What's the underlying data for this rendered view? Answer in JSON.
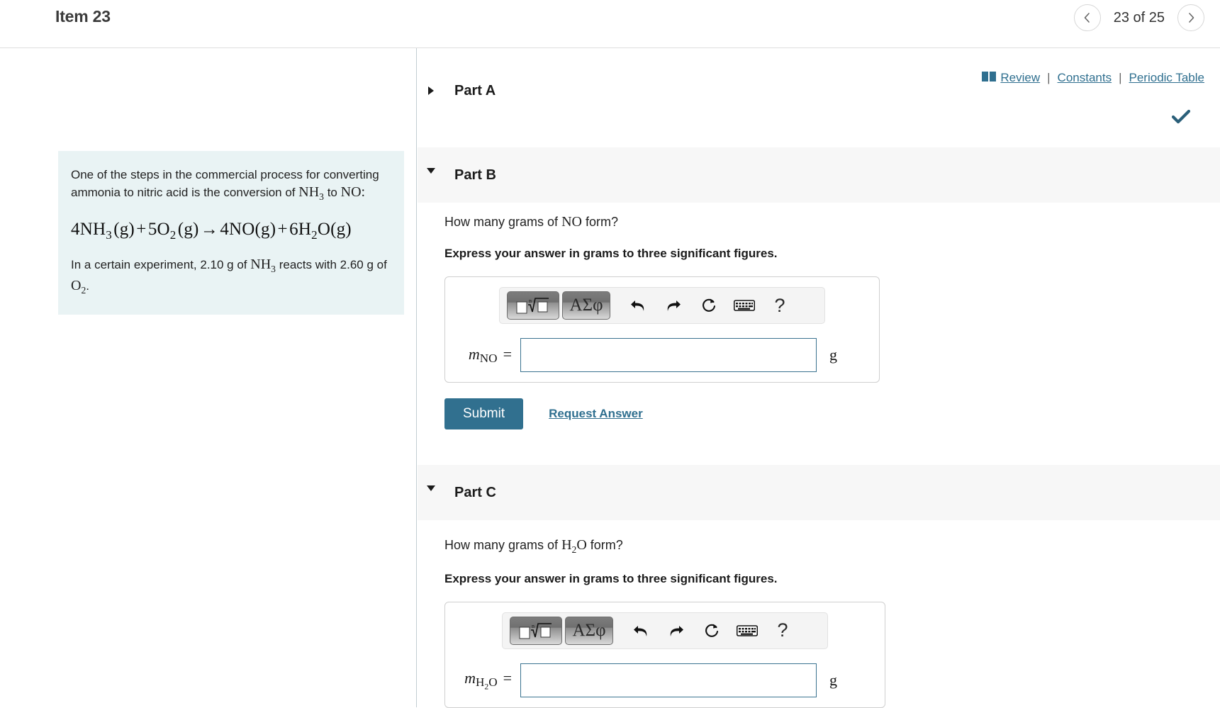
{
  "header": {
    "item_title": "Item 23",
    "prev_icon": "chevron-left-icon",
    "next_icon": "chevron-right-icon",
    "pagination": "23 of 25"
  },
  "utility": {
    "book_icon": "book-icon",
    "review": "Review",
    "separator": "|",
    "constants": "Constants",
    "periodic_table": "Periodic Table",
    "link_color": "#2f6f8f"
  },
  "problem": {
    "line1": "One of the steps in the commercial process for converting ammonia to nitric acid is the conversion of",
    "formula_nh3": "NH",
    "formula_nh3_sub": "3",
    "mid": "to",
    "formula_no": "NO:",
    "equation": "4NH3 (g) + 5O2 (g) → 4NO(g) + 6H2O(g)",
    "line2_pre": "In a certain experiment, 2.10 g of",
    "line2_mid": "reacts with 2.60 g of",
    "line2_sub_o": "O",
    "line2_sub_o_num": "2",
    "line2_end": ".",
    "background_color": "#e9f3f4"
  },
  "parts": {
    "a": {
      "label": "Part A",
      "triangle": "triangle-right-icon",
      "expanded": false,
      "completed_icon": "check-icon",
      "completed_color": "#2a5f79"
    },
    "b": {
      "label": "Part B",
      "triangle": "triangle-down-icon",
      "expanded": true,
      "question_pre": "How many grams of",
      "question_species": "NO",
      "question_post": "form?",
      "instruction": "Express your answer in grams to three significant figures.",
      "answer_label_m": "m",
      "answer_label_sub": "NO",
      "answer_label_eq": "=",
      "answer_value": "",
      "unit": "g",
      "submit_label": "Submit",
      "request_answer_label": "Request Answer",
      "submit_color": "#31708f"
    },
    "c": {
      "label": "Part C",
      "triangle": "triangle-down-icon",
      "expanded": true,
      "question_pre": "How many grams of",
      "question_species_h": "H",
      "question_species_h_sub": "2",
      "question_species_o": "O",
      "question_post": "form?",
      "instruction": "Express your answer in grams to three significant figures.",
      "answer_label_m": "m",
      "answer_label_sub_h": "H",
      "answer_label_sub_h_num": "2",
      "answer_label_sub_o": "O",
      "answer_label_eq": "=",
      "answer_value": "",
      "unit": "g"
    }
  },
  "math_toolbar": {
    "template_button": "math-template-icon",
    "greek_button": "ΑΣφ",
    "undo_icon": "undo-icon",
    "redo_icon": "redo-icon",
    "reset_icon": "reset-icon",
    "keyboard_icon": "keyboard-icon",
    "help_label": "?"
  }
}
